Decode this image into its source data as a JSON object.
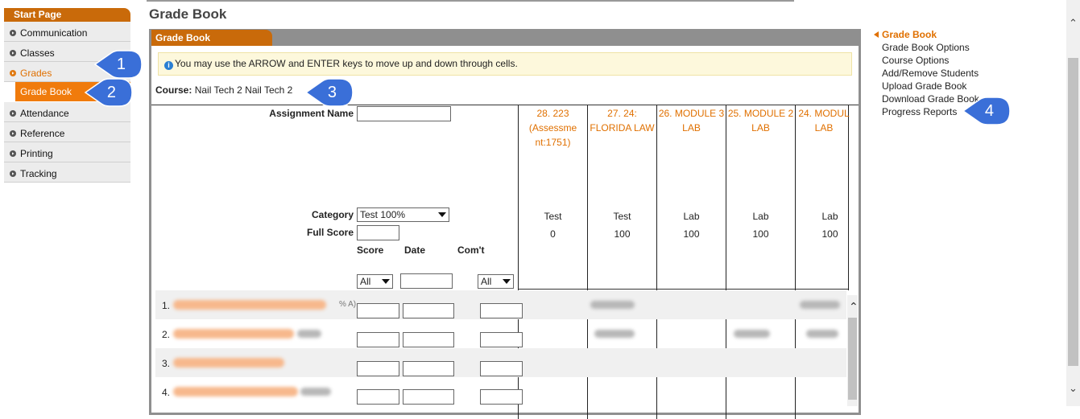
{
  "nav": {
    "header": "Start Page",
    "items": [
      {
        "label": "Communication"
      },
      {
        "label": "Classes"
      },
      {
        "label": "Grades"
      },
      {
        "label": "Grade Book"
      },
      {
        "label": "Attendance"
      },
      {
        "label": "Reference"
      },
      {
        "label": "Printing"
      },
      {
        "label": "Tracking"
      }
    ]
  },
  "page": {
    "title": "Grade Book"
  },
  "panel": {
    "tab": "Grade Book",
    "info": "You may use the ARROW and ENTER keys to move up and down through cells.",
    "course_label": "Course:",
    "course_value": "Nail Tech 2 Nail Tech 2"
  },
  "filters": {
    "assignment_name_label": "Assignment Name",
    "category_label": "Category",
    "category_value": "Test 100%",
    "full_score_label": "Full Score",
    "score_label": "Score",
    "date_label": "Date",
    "comment_label": "Com't",
    "score_filter": "All",
    "comment_filter": "All"
  },
  "columns": [
    {
      "title": "28. 223 (Assessme nt:1751)",
      "category": "Test",
      "full": "0"
    },
    {
      "title": "27. 24: FLORIDA LAW",
      "category": "Test",
      "full": "100"
    },
    {
      "title": "26. MODULE 3 LAB",
      "category": "Lab",
      "full": "100"
    },
    {
      "title": "25. MODULE 2 LAB",
      "category": "Lab",
      "full": "100"
    },
    {
      "title": "24. MODUL LAB",
      "category": "Lab",
      "full": "100"
    }
  ],
  "rows": [
    {
      "num": "1.",
      "pct": "% A)"
    },
    {
      "num": "2."
    },
    {
      "num": "3."
    },
    {
      "num": "4."
    }
  ],
  "right_links": {
    "head": "Grade Book",
    "items": [
      "Grade Book Options",
      "Course Options",
      "Add/Remove Students",
      "Upload Grade Book",
      "Download Grade Book",
      "Progress Reports"
    ]
  },
  "callouts": [
    "1",
    "2",
    "3",
    "4"
  ],
  "colors": {
    "accent": "#e07000",
    "tab": "#c96a0a",
    "callout": "#3a6fd8"
  }
}
